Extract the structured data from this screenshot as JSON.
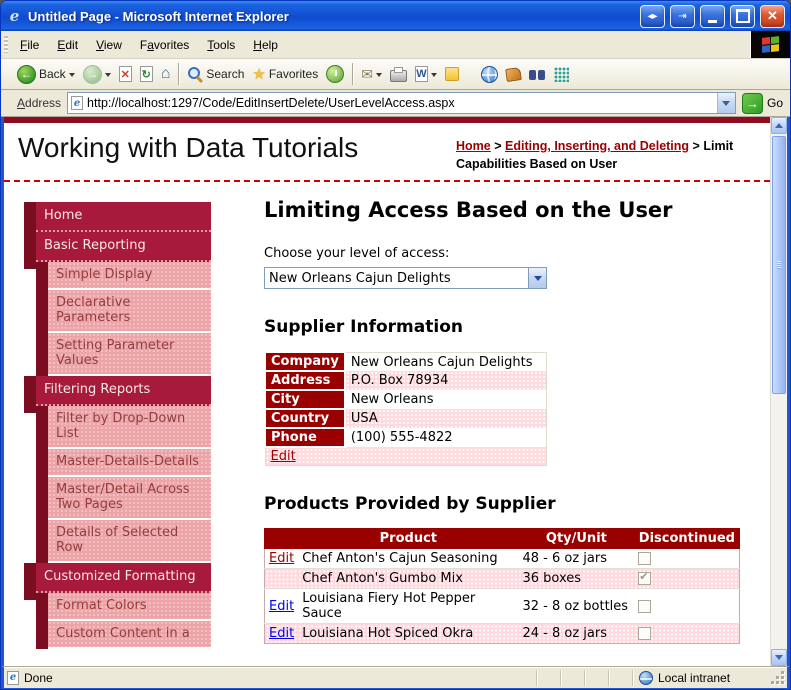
{
  "window": {
    "title": "Untitled Page - Microsoft Internet Explorer"
  },
  "titlebar_buttons": {
    "switch_glyph": "◂▸",
    "detach_glyph": "⇥",
    "close_glyph": "✕"
  },
  "menu": {
    "items": [
      {
        "label": "File",
        "accel": 0
      },
      {
        "label": "Edit",
        "accel": 0
      },
      {
        "label": "View",
        "accel": 0
      },
      {
        "label": "Favorites",
        "accel": 1
      },
      {
        "label": "Tools",
        "accel": 0
      },
      {
        "label": "Help",
        "accel": 0
      }
    ]
  },
  "toolbar": {
    "back_label": "Back",
    "search_label": "Search",
    "favorites_label": "Favorites"
  },
  "icons": {
    "back_arrow": "←",
    "forward_arrow": "→",
    "stop": "✕",
    "refresh": "↻",
    "home": "⌂",
    "favorites_star": "★",
    "mail": "✉",
    "word": "W",
    "check": "✔",
    "go_arrow": "→",
    "ie_e": "e"
  },
  "address": {
    "label": "Address",
    "accel": 0,
    "url": "http://localhost:1297/Code/EditInsertDelete/UserLevelAccess.aspx",
    "go_label": "Go"
  },
  "page_header": {
    "site_title": "Working with Data Tutorials",
    "breadcrumb": {
      "link1": "Home",
      "sep1": ">",
      "link2": "Editing, Inserting, and Deleting",
      "sep2": ">",
      "current": "Limit Capabilities Based on User"
    }
  },
  "sidebar": {
    "items": [
      {
        "label": "Home",
        "level": 1
      },
      {
        "label": "Basic Reporting",
        "level": 1
      },
      {
        "label": "Simple Display",
        "level": 2
      },
      {
        "label": "Declarative Parameters",
        "level": 2
      },
      {
        "label": "Setting Parameter Values",
        "level": 2
      },
      {
        "label": "Filtering Reports",
        "level": 1
      },
      {
        "label": "Filter by Drop-Down List",
        "level": 2
      },
      {
        "label": "Master-Details-Details",
        "level": 2
      },
      {
        "label": "Master/Detail Across Two Pages",
        "level": 2
      },
      {
        "label": "Details of Selected Row",
        "level": 2
      },
      {
        "label": "Customized Formatting",
        "level": 1
      },
      {
        "label": "Format Colors",
        "level": 2
      },
      {
        "label": "Custom Content in a",
        "level": 2
      }
    ]
  },
  "main": {
    "heading": "Limiting Access Based on the User",
    "access_prompt": "Choose your level of access:",
    "access_dropdown_value": "New Orleans Cajun Delights",
    "supplier": {
      "heading": "Supplier Information",
      "fields": [
        {
          "label": "Company",
          "value": "New Orleans Cajun Delights"
        },
        {
          "label": "Address",
          "value": "P.O. Box 78934"
        },
        {
          "label": "City",
          "value": "New Orleans"
        },
        {
          "label": "Country",
          "value": "USA"
        },
        {
          "label": "Phone",
          "value": "(100) 555-4822"
        }
      ],
      "edit_label": "Edit"
    },
    "products": {
      "heading": "Products Provided by Supplier",
      "columns": [
        "",
        "Product",
        "Qty/Unit",
        "Discontinued"
      ],
      "rows": [
        {
          "edit": "Edit",
          "edit_color": "darkred",
          "product": "Chef Anton's Cajun Seasoning",
          "qty": "48 - 6 oz jars",
          "discontinued": false
        },
        {
          "edit": "",
          "edit_color": "",
          "product": "Chef Anton's Gumbo Mix",
          "qty": "36 boxes",
          "discontinued": true
        },
        {
          "edit": "Edit",
          "edit_color": "blue",
          "product": "Louisiana Fiery Hot Pepper Sauce",
          "qty": "32 - 8 oz bottles",
          "discontinued": false
        },
        {
          "edit": "Edit",
          "edit_color": "blue",
          "product": "Louisiana Hot Spiced Okra",
          "qty": "24 - 8 oz jars",
          "discontinued": false
        }
      ]
    }
  },
  "statusbar": {
    "status": "Done",
    "zone": "Local intranet"
  },
  "colors": {
    "xp_blue": "#2456C8",
    "chrome_beige": "#ECE9D8",
    "dark_red": "#990000",
    "nav_crimson": "#A81A3B",
    "nav_maroon": "#7A0D20",
    "nav_pink": "#EBA5A8",
    "row_pink": "#FFD9DD",
    "link_blue": "#0000EE",
    "header_bar_red": "#8E0B20"
  }
}
